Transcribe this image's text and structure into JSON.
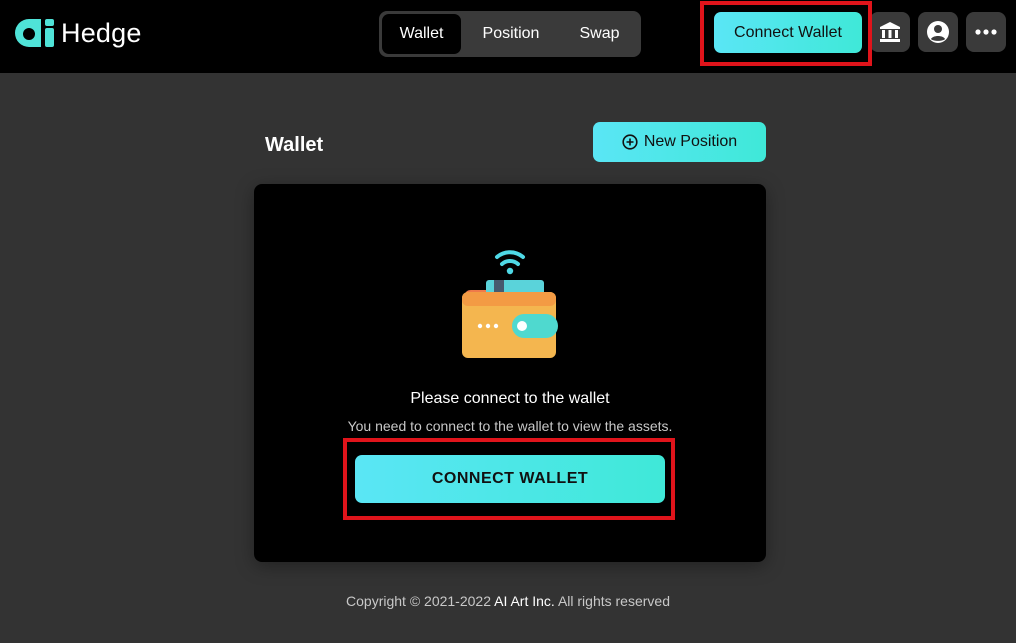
{
  "app": {
    "logo_mark": "ai",
    "logo_text": "Hedge"
  },
  "nav": {
    "tabs": [
      {
        "label": "Wallet",
        "active": true
      },
      {
        "label": "Position",
        "active": false
      },
      {
        "label": "Swap",
        "active": false
      }
    ]
  },
  "header": {
    "connect_label": "Connect Wallet",
    "icons": [
      "bank-icon",
      "account-icon",
      "more-icon"
    ]
  },
  "main": {
    "title": "Wallet",
    "new_position_label": "New Position",
    "new_position_icon": "plus-circle-icon"
  },
  "card": {
    "illustration": "wallet-wifi-icon",
    "title": "Please connect to the wallet",
    "subtitle": "You need to connect to the wallet to view the assets.",
    "connect_label": "CONNECT WALLET"
  },
  "footer": {
    "copyright": "Copyright © 2021-2022",
    "brand": "AI Art Inc.",
    "rights": "All rights reserved"
  },
  "colors": {
    "accent_start": "#5ae6f5",
    "accent_end": "#3fe8d8",
    "header_bg": "#000000",
    "page_bg": "#333333",
    "highlight": "#e0141b"
  }
}
